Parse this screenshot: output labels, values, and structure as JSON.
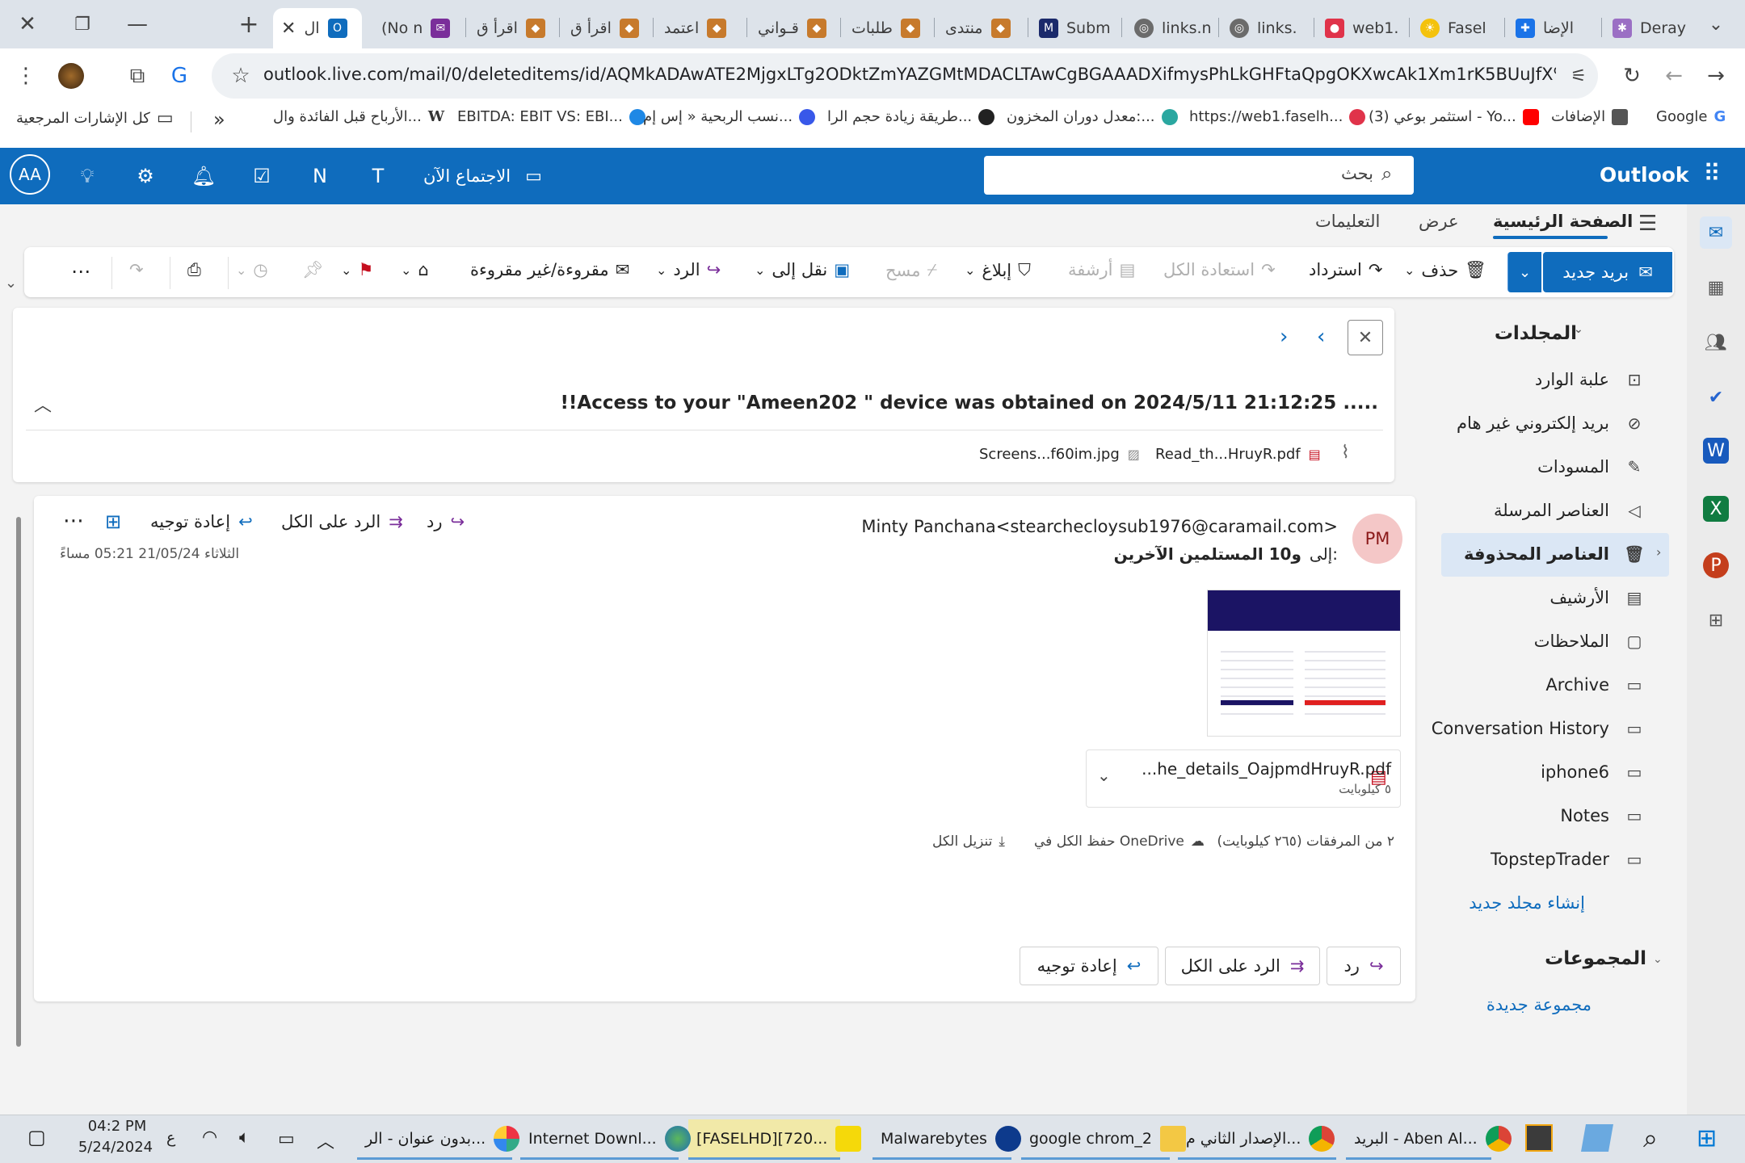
{
  "browser": {
    "tabs": [
      {
        "label": "Deray",
        "icon": "app-icon"
      },
      {
        "label": "الإضا",
        "icon": "puzzle-icon"
      },
      {
        "label": "Fasel",
        "icon": "bulb-icon"
      },
      {
        "label": "web1.",
        "icon": "pin-icon"
      },
      {
        "label": "links.",
        "icon": "globe-icon"
      },
      {
        "label": "links.n",
        "icon": "globe-icon"
      },
      {
        "label": "Subm",
        "icon": "m-icon"
      },
      {
        "label": "منتدى",
        "icon": "forum-icon"
      },
      {
        "label": "طلبات",
        "icon": "forum-icon"
      },
      {
        "label": "قـواني",
        "icon": "forum-icon"
      },
      {
        "label": "اعتمد",
        "icon": "forum-icon"
      },
      {
        "label": "اقرأ ق",
        "icon": "forum-icon"
      },
      {
        "label": "اقرأ ق",
        "icon": "forum-icon"
      },
      {
        "label": "(No n",
        "icon": "mail-icon"
      },
      {
        "label": "ال",
        "icon": "outlook-icon",
        "active": true
      }
    ],
    "url": "outlook.live.com/mail/0/deleteditems/id/AQMkADAwATE2MjgxLTg2ODktZmYAZGMtMDACLTAwCgBGAAADXifmysPhLkGHFtaQpgOKXwcAk1Xm1rK5BUuJfX%2BdCHojJAAA...",
    "bookmarks": [
      {
        "label": "Google",
        "icon": "google-icon",
        "color": "#4285f4"
      },
      {
        "label": "الإضافات",
        "icon": "puzzle-icon",
        "color": "#555555"
      },
      {
        "label": "(3) استثمر بوعي - Yo...",
        "icon": "youtube-icon",
        "color": "#ff0000"
      },
      {
        "label": "https://web1.faselh...",
        "icon": "pin-icon",
        "color": "#e0334a"
      },
      {
        "label": "معدل دوران المخزون:...",
        "icon": "chart-icon",
        "color": "#2aa7a0"
      },
      {
        "label": "طريقة زيادة حجم الرا...",
        "icon": "avatar-icon",
        "color": "#222222"
      },
      {
        "label": "نسب الربحية « إس إم...",
        "icon": "wp-icon",
        "color": "#3858e9"
      },
      {
        "label": "EBITDA: EBIT VS: EBI...",
        "icon": "c-icon",
        "color": "#1e88e5"
      },
      {
        "label": "الأرباح قبل الفائدة وال...",
        "icon": "wiki-icon",
        "color": "#222222"
      }
    ],
    "all_bookmarks": "كل الإشارات المرجعية"
  },
  "outlook": {
    "brand": "Outlook",
    "search_placeholder": "بحث",
    "meet_now": "الاجتماع الآن",
    "avatar_initials": "AA",
    "ribbon_tabs": [
      "الصفحة الرئيسية",
      "عرض",
      "التعليمات"
    ],
    "commands": {
      "new_mail": "بريد جديد",
      "delete": "حذف",
      "restore": "استرداد",
      "restore_all": "استعادة الكل",
      "archive": "أرشفة",
      "report": "إبلاغ",
      "sweep": "مسح",
      "move_to": "نقل إلى",
      "reply": "الرد",
      "read_unread": "مقروءة/غير مقروءة"
    },
    "folders_title": "المجلدات",
    "folders": [
      {
        "label": "علبة الوارد",
        "icon": "inbox-icon"
      },
      {
        "label": "بريد إلكتروني غير هام",
        "icon": "junk-icon"
      },
      {
        "label": "المسودات",
        "icon": "draft-icon"
      },
      {
        "label": "العناصر المرسلة",
        "icon": "sent-icon"
      },
      {
        "label": "العناصر المحذوفة",
        "icon": "trash-icon",
        "selected": true
      },
      {
        "label": "الأرشيف",
        "icon": "archive-icon"
      },
      {
        "label": "الملاحظات",
        "icon": "note-icon"
      },
      {
        "label": "Archive",
        "icon": "folder-icon"
      },
      {
        "label": "Conversation History",
        "icon": "folder-icon"
      },
      {
        "label": "iphone6",
        "icon": "folder-icon"
      },
      {
        "label": "Notes",
        "icon": "folder-icon"
      },
      {
        "label": "TopstepTrader",
        "icon": "folder-icon"
      }
    ],
    "create_folder": "إنشاء مجلد جديد",
    "groups_title": "المجموعات",
    "new_group": "مجموعة جديدة"
  },
  "message": {
    "subject": "!!Access to your \"Ameen202 \" device was obtained on 2024/5/11 21:12:25 .....",
    "subject_attachments": [
      "Read_th...HruyR.pdf",
      "Screens...f60im.jpg"
    ],
    "sender_initials": "PM",
    "sender": "Minty Panchana<stearchecloysub1976@caramail.com>",
    "to_label": "إلى:",
    "recipients": "و10 المستلمين الآخرين",
    "date": "الثلاثاء 21/05/24 05:21 مساءً",
    "reply": "رد",
    "reply_all": "الرد على الكل",
    "forward": "إعادة توجيه",
    "attachment_name": "...he_details_OajpmdHruyR.pdf",
    "attachment_size": "٥ كيلوبايت",
    "attachments_summary": "٢ من المرفقات (٢٦٥ كيلوبايت)",
    "save_onedrive": "حفظ الكل في OneDrive",
    "download_all": "تنزيل الكل"
  },
  "taskbar": {
    "items": [
      {
        "label": "البريد - Aben Al...",
        "icon": "chrome-icon"
      },
      {
        "label": "الإصدار الثاني م...",
        "icon": "chrome-icon"
      },
      {
        "label": "google chrom_2",
        "icon": "folder-icon"
      },
      {
        "label": "Malwarebytes",
        "icon": "malwarebytes-icon"
      },
      {
        "label": "[FASELHD][720...",
        "icon": "player-icon"
      },
      {
        "label": "Internet Downl...",
        "icon": "idm-icon"
      },
      {
        "label": "بدون عنوان - الر...",
        "icon": "paint-icon"
      }
    ],
    "lang": "ع",
    "time": "04:2 PM",
    "date": "5/24/2024"
  }
}
